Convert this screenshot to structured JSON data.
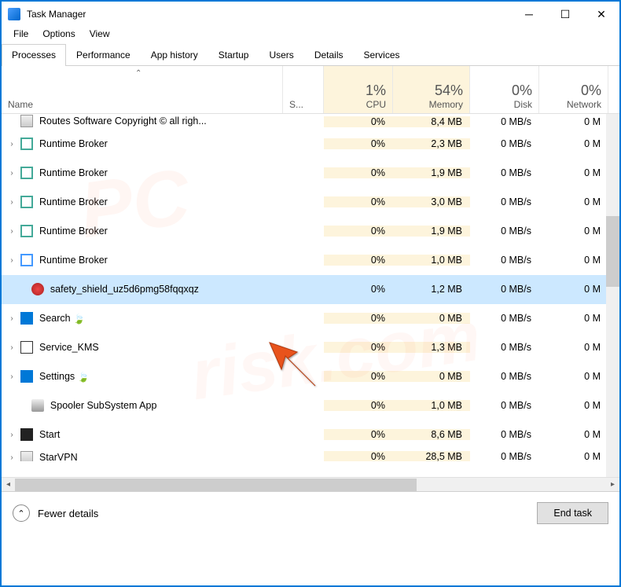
{
  "title": "Task Manager",
  "menu": [
    "File",
    "Options",
    "View"
  ],
  "tabs": [
    "Processes",
    "Performance",
    "App history",
    "Startup",
    "Users",
    "Details",
    "Services"
  ],
  "active_tab": 0,
  "columns": {
    "name": "Name",
    "status": "S...",
    "cpu": {
      "percent": "1%",
      "label": "CPU"
    },
    "memory": {
      "percent": "54%",
      "label": "Memory"
    },
    "disk": {
      "percent": "0%",
      "label": "Disk"
    },
    "network": {
      "percent": "0%",
      "label": "Network"
    }
  },
  "rows": [
    {
      "exp": "",
      "icon": "i-generic",
      "name": "Routes Software Copyright © all righ...",
      "cpu": "0%",
      "mem": "8,4 MB",
      "disk": "0 MB/s",
      "net": "0 M",
      "cut": "top"
    },
    {
      "exp": "›",
      "icon": "i-window",
      "name": "Runtime Broker",
      "cpu": "0%",
      "mem": "2,3 MB",
      "disk": "0 MB/s",
      "net": "0 M"
    },
    {
      "exp": "›",
      "icon": "i-window",
      "name": "Runtime Broker",
      "cpu": "0%",
      "mem": "1,9 MB",
      "disk": "0 MB/s",
      "net": "0 M"
    },
    {
      "exp": "›",
      "icon": "i-window",
      "name": "Runtime Broker",
      "cpu": "0%",
      "mem": "3,0 MB",
      "disk": "0 MB/s",
      "net": "0 M"
    },
    {
      "exp": "›",
      "icon": "i-window",
      "name": "Runtime Broker",
      "cpu": "0%",
      "mem": "1,9 MB",
      "disk": "0 MB/s",
      "net": "0 M"
    },
    {
      "exp": "›",
      "icon": "i-window-b",
      "name": "Runtime Broker",
      "cpu": "0%",
      "mem": "1,0 MB",
      "disk": "0 MB/s",
      "net": "0 M"
    },
    {
      "exp": "",
      "icon": "i-shield",
      "name": "safety_shield_uz5d6pmg58fqqxqz",
      "cpu": "0%",
      "mem": "1,2 MB",
      "disk": "0 MB/s",
      "net": "0 M",
      "selected": true,
      "indent": true
    },
    {
      "exp": "›",
      "icon": "i-search",
      "name": "Search",
      "cpu": "0%",
      "mem": "0 MB",
      "disk": "0 MB/s",
      "net": "0 M",
      "leaf": true
    },
    {
      "exp": "›",
      "icon": "i-kms",
      "name": "Service_KMS",
      "cpu": "0%",
      "mem": "1,3 MB",
      "disk": "0 MB/s",
      "net": "0 M"
    },
    {
      "exp": "›",
      "icon": "i-settings",
      "name": "Settings",
      "cpu": "0%",
      "mem": "0 MB",
      "disk": "0 MB/s",
      "net": "0 M",
      "leaf": true
    },
    {
      "exp": "",
      "icon": "i-printer",
      "name": "Spooler SubSystem App",
      "cpu": "0%",
      "mem": "1,0 MB",
      "disk": "0 MB/s",
      "net": "0 M",
      "indent": true
    },
    {
      "exp": "›",
      "icon": "i-start",
      "name": "Start",
      "cpu": "0%",
      "mem": "8,6 MB",
      "disk": "0 MB/s",
      "net": "0 M"
    },
    {
      "exp": "›",
      "icon": "i-generic",
      "name": "StarVPN",
      "cpu": "0%",
      "mem": "28,5 MB",
      "disk": "0 MB/s",
      "net": "0 M",
      "cut": "bottom"
    }
  ],
  "footer": {
    "fewer": "Fewer details",
    "end_task": "End task"
  }
}
